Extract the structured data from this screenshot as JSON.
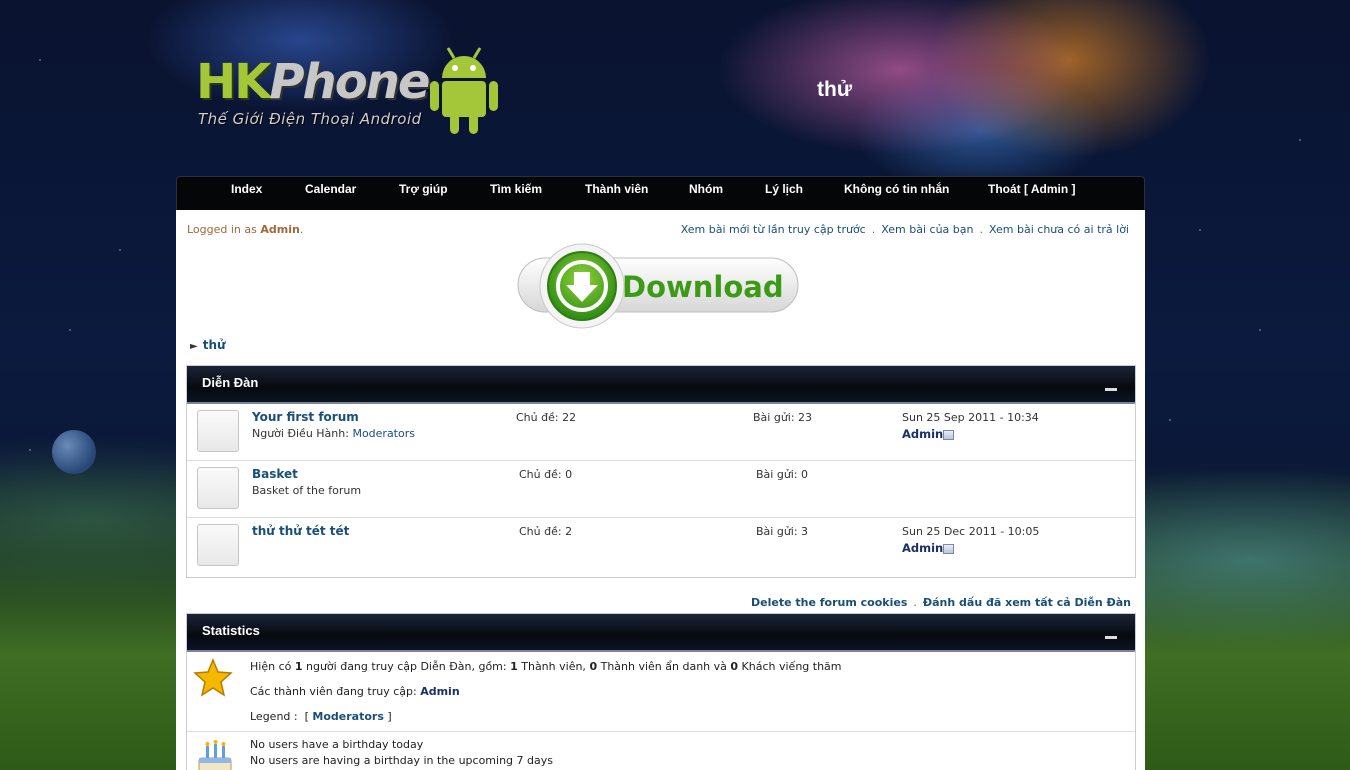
{
  "header": {
    "logo_main": "HK",
    "logo_phone": "Phone",
    "logo_tagline": "Thế Giới Điện Thoại Android",
    "site_title": "thử"
  },
  "nav": {
    "items": [
      "Index",
      "Calendar",
      "Trợ giúp",
      "Tìm kiếm",
      "Thành viên",
      "Nhóm",
      "Lý lịch",
      "Không có tin nhắn",
      "Thoát [ Admin ]"
    ]
  },
  "top": {
    "logged_prefix": "Logged in as",
    "logged_user": "Admin",
    "logged_suffix": ".",
    "links": [
      "Xem bài mới từ lần truy cập trước",
      "Xem bài của bạn",
      "Xem bài chưa có ai trả lời"
    ],
    "separator": "."
  },
  "download_label": "Download",
  "breadcrumb": "thử",
  "forums": {
    "title": "Diễn Đàn",
    "rows": [
      {
        "name": "Your first forum",
        "desc_prefix": "Người Điều Hành:",
        "desc_link": "Moderators",
        "topics": "Chủ đề: 22",
        "posts": "Bài gửi: 23",
        "last_date": "Sun 25 Sep 2011 - 10:34",
        "last_user": "Admin"
      },
      {
        "name": "Basket",
        "desc_prefix": "Basket of the forum",
        "desc_link": "",
        "topics": "Chủ đề: 0",
        "posts": "Bài gửi: 0",
        "last_date": "",
        "last_user": ""
      },
      {
        "name": "thử thử tét tét",
        "desc_prefix": "",
        "desc_link": "",
        "topics": "Chủ đề: 2",
        "posts": "Bài gửi: 3",
        "last_date": "Sun 25 Dec 2011 - 10:05",
        "last_user": "Admin"
      }
    ]
  },
  "bottom_links": [
    "Delete the forum cookies",
    "Đánh dấu đã xem tất cả Diễn Đàn"
  ],
  "stats": {
    "title": "Statistics",
    "online": {
      "t1": "Hiện có",
      "n1": "1",
      "t2": "người đang truy cập Diễn Đàn, gồm:",
      "n2": "1",
      "t3": "Thành viên,",
      "n3": "0",
      "t4": "Thành viên ẩn danh và",
      "n4": "0",
      "t5": "Khách viếng thăm"
    },
    "members_label": "Các thành viên đang truy cập:",
    "members_user": "Admin",
    "legend_label": "Legend :",
    "legend_open": "[",
    "legend_item": "Moderators",
    "legend_close": "]",
    "birthday_today": "No users have a birthday today",
    "birthday_upcoming": "No users are having a birthday in the upcoming 7 days"
  }
}
